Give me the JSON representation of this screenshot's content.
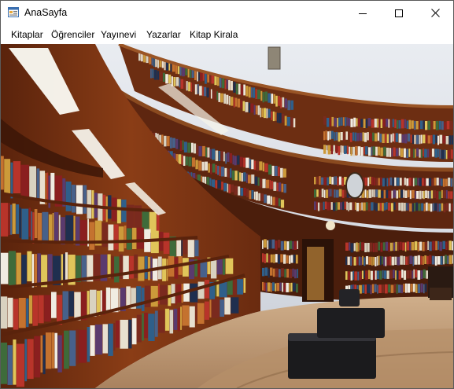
{
  "window": {
    "title": "AnaSayfa",
    "icons": {
      "app": "app-form-icon",
      "minimize": "minimize-icon",
      "maximize": "maximize-icon",
      "close": "close-icon"
    }
  },
  "menu": {
    "items": [
      {
        "label": "Kitaplar"
      },
      {
        "label": "Öğrenciler"
      },
      {
        "label": "Yayınevi"
      },
      {
        "label": "Yazarlar"
      },
      {
        "label": "Kitap Kirala"
      }
    ]
  },
  "background": {
    "image": "library-interior-photo",
    "colors": {
      "wood": "#7a3413",
      "ceiling": "#dfe3ea",
      "floor": "#c7a27e",
      "shelf_shadow": "#2b1208"
    }
  }
}
